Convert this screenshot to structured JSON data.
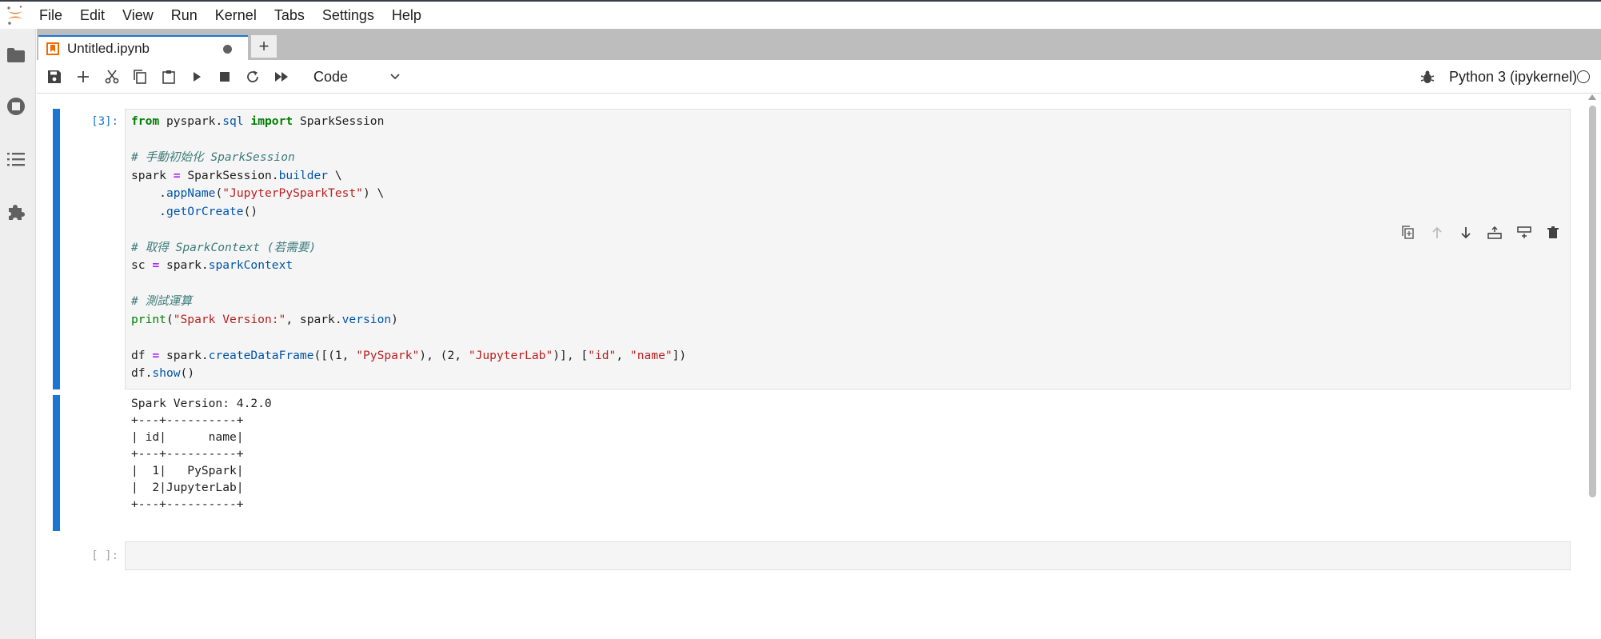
{
  "menu": [
    "File",
    "Edit",
    "View",
    "Run",
    "Kernel",
    "Tabs",
    "Settings",
    "Help"
  ],
  "sidebar_icons": [
    "folder-icon",
    "running-icon",
    "toc-icon",
    "extension-icon"
  ],
  "tab": {
    "title": "Untitled.ipynb"
  },
  "toolbar": {
    "cell_type": "Code",
    "kernel_name": "Python 3 (ipykernel)"
  },
  "cells": [
    {
      "prompt": "[3]:",
      "output": "Spark Version: 4.2.0\n+---+----------+\n| id|      name|\n+---+----------+\n|  1|   PySpark|\n|  2|JupyterLab|\n+---+----------+"
    },
    {
      "prompt": "[ ]:"
    }
  ],
  "code_lines": [
    "from pyspark.sql import SparkSession",
    "",
    "# 手動初始化 SparkSession",
    "spark = SparkSession.builder \\",
    "    .appName(\"JupyterPySparkTest\") \\",
    "    .getOrCreate()",
    "",
    "# 取得 SparkContext (若需要)",
    "sc = spark.sparkContext",
    "",
    "# 測試運算",
    "print(\"Spark Version:\", spark.version)",
    "",
    "df = spark.createDataFrame([(1, \"PySpark\"), (2, \"JupyterLab\")], [\"id\", \"name\"])",
    "df.show()"
  ],
  "colors": {
    "accent": "#1976d2",
    "keyword": "#008000",
    "operator": "#aa22ff",
    "comment": "#3d7b7b",
    "string": "#ba2121",
    "attribute": "#0055aa"
  }
}
